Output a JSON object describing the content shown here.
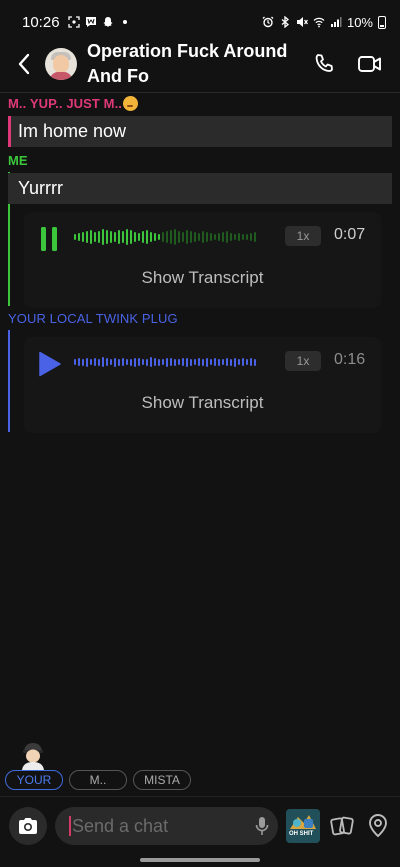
{
  "status_bar": {
    "time": "10:26",
    "battery": "10%",
    "left_icons": [
      "screenshot-icon",
      "whatsapp-icon",
      "snapchat-icon",
      "dot-icon"
    ],
    "right_icons": [
      "alarm-icon",
      "bluetooth-icon",
      "mute-icon",
      "wifi-icon",
      "signal-icon",
      "battery-icon"
    ]
  },
  "header": {
    "title": "Operation Fuck Around And Fo",
    "back_icon": "chevron-left-icon",
    "call_icon": "phone-icon",
    "video_icon": "video-icon"
  },
  "messages": [
    {
      "sender": "M.. YUP.. JUST M..",
      "sender_color": "#e0397a",
      "text": "Im home now"
    },
    {
      "sender": "ME",
      "sender_color": "#3cc63c",
      "text": "Yurrrr",
      "voice": {
        "state": "playing",
        "speed": "1x",
        "duration": "0:07",
        "transcript_label": "Show Transcript",
        "progress": 0.48
      }
    },
    {
      "sender": "YOUR LOCAL TWINK PLUG",
      "sender_color": "#4a63e6",
      "voice": {
        "state": "paused",
        "speed": "1x",
        "duration": "0:16",
        "transcript_label": "Show Transcript",
        "progress": 0
      }
    }
  ],
  "participants": {
    "chips": [
      "YOUR",
      "M..",
      "MISTA"
    ],
    "active": "YOUR"
  },
  "composer": {
    "placeholder": "Send a chat",
    "camera_icon": "camera-icon",
    "mic_icon": "mic-icon",
    "sticker_text": "OH SHIT",
    "cards_icon": "cards-icon",
    "location_icon": "location-icon"
  },
  "colors": {
    "background": "#121212",
    "green": "#3cc63c",
    "blue": "#4a63e6",
    "pink": "#e0397a"
  }
}
